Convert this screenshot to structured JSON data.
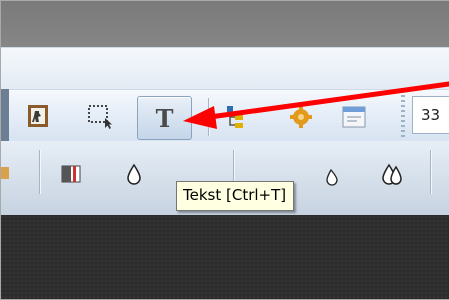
{
  "toolbar_top": {
    "buttons": [
      {
        "name": "frame-select-icon"
      },
      {
        "name": "selection-rectangle-icon"
      },
      {
        "name": "text-tool-icon",
        "glyph": "T"
      },
      {
        "name": "hierarchy-icon"
      },
      {
        "name": "gear-icon"
      },
      {
        "name": "window-icon"
      }
    ],
    "zoom_value": "33"
  },
  "toolbar_bottom": {
    "buttons": [
      {
        "name": "contrast-icon"
      },
      {
        "name": "drop-icon"
      },
      {
        "name": "drops-icon"
      }
    ]
  },
  "tooltip": {
    "text": "Tekst [Ctrl+T]"
  },
  "annotation": {
    "arrow_color": "#ff0000"
  },
  "colors": {
    "toolbar_light": "#e6eef8",
    "canvas_dark": "#2d2d2d",
    "tooltip_bg": "#ffffe1"
  }
}
